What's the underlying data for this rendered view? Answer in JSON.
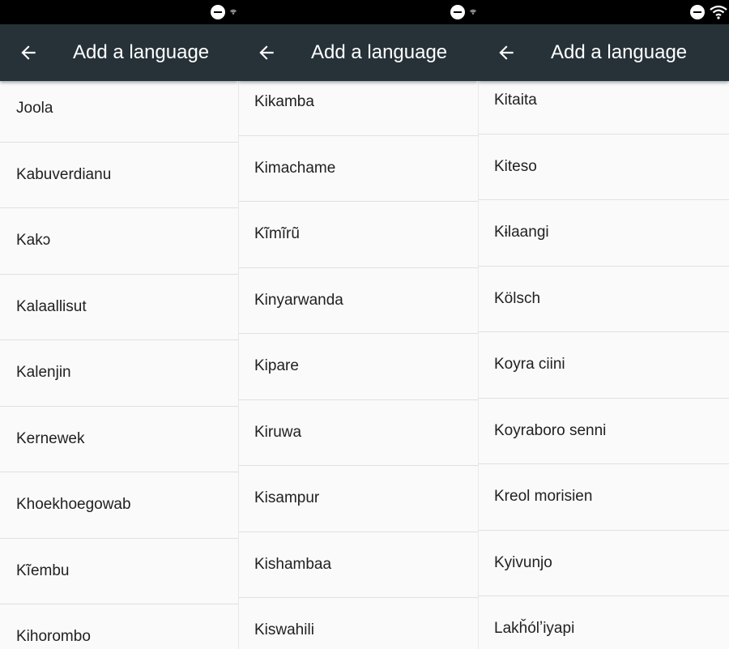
{
  "panels": [
    {
      "title": "Add a language",
      "languages": [
        "Joola",
        "Kabuverdianu",
        "Kakɔ",
        "Kalaallisut",
        "Kalenjin",
        "Kernewek",
        "Khoekhoegowab",
        "Kĩembu",
        "Kihorombo"
      ]
    },
    {
      "title": "Add a language",
      "languages": [
        "Kikamba",
        "Kimachame",
        "Kĩmĩrũ",
        "Kinyarwanda",
        "Kipare",
        "Kiruwa",
        "Kisampur",
        "Kishambaa",
        "Kiswahili"
      ]
    },
    {
      "title": "Add a language",
      "languages": [
        "Kitaita",
        "Kiteso",
        "Kɨlaangi",
        "Kölsch",
        "Koyra ciini",
        "Koyraboro senni",
        "Kreol morisien",
        "Kyivunjo",
        "Lakȟólʼiyapi"
      ]
    }
  ],
  "colors": {
    "appbar": "#263238",
    "statusbar": "#000000",
    "background": "#fafafa"
  }
}
